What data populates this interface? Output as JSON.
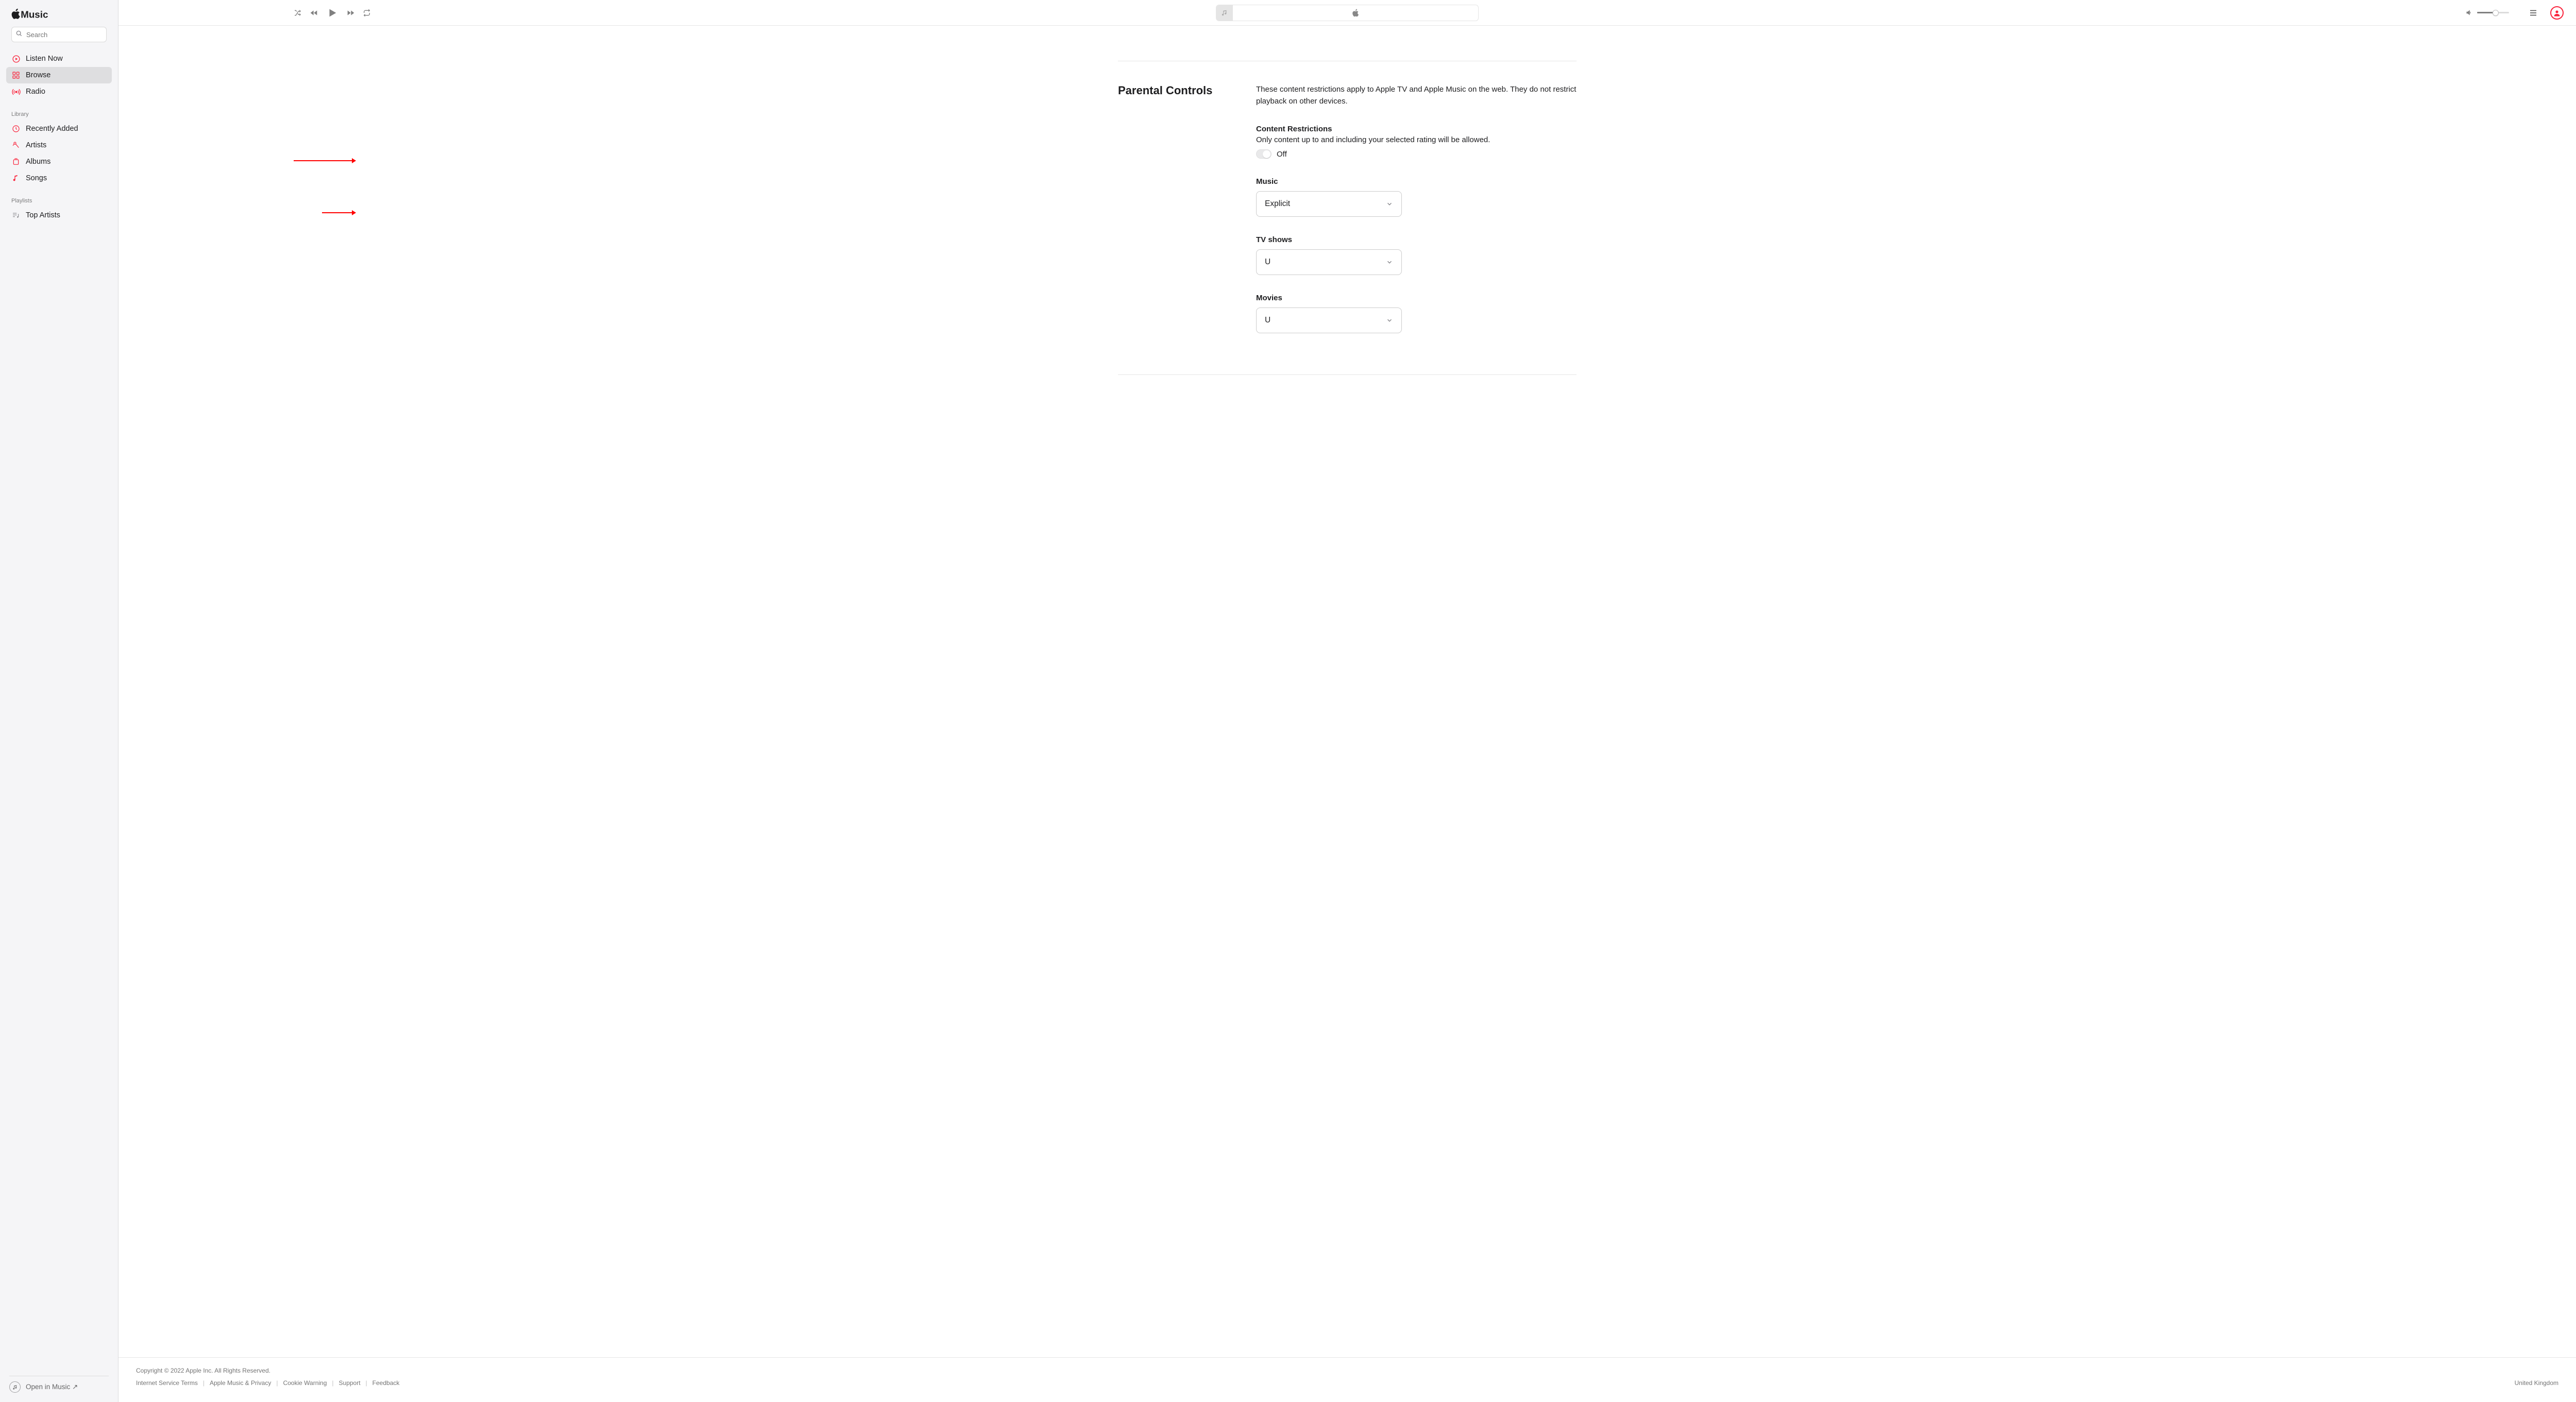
{
  "app": {
    "name": "Music"
  },
  "search": {
    "placeholder": "Search"
  },
  "sidebar": {
    "main": [
      {
        "label": "Listen Now",
        "icon": "play-circle"
      },
      {
        "label": "Browse",
        "icon": "grid",
        "active": true
      },
      {
        "label": "Radio",
        "icon": "broadcast"
      }
    ],
    "library_heading": "Library",
    "library": [
      {
        "label": "Recently Added",
        "icon": "clock"
      },
      {
        "label": "Artists",
        "icon": "mic"
      },
      {
        "label": "Albums",
        "icon": "album"
      },
      {
        "label": "Songs",
        "icon": "note"
      }
    ],
    "playlists_heading": "Playlists",
    "playlists": [
      {
        "label": "Top Artists",
        "icon": "playlist"
      }
    ],
    "open_in": "Open in Music ↗"
  },
  "settings": {
    "title": "Parental Controls",
    "description": "These content restrictions apply to Apple TV and Apple Music on the web. They do not restrict playback on other devices.",
    "restrictions_heading": "Content Restrictions",
    "restrictions_sub": "Only content up to and including your selected rating will be allowed.",
    "toggle_state_label": "Off",
    "groups": {
      "music": {
        "label": "Music",
        "value": "Explicit"
      },
      "tv": {
        "label": "TV shows",
        "value": "U"
      },
      "movies": {
        "label": "Movies",
        "value": "U"
      }
    }
  },
  "footer": {
    "copyright_prefix": "Copyright © 2022 ",
    "company": "Apple Inc.",
    "copyright_suffix": " All Rights Reserved.",
    "links": [
      "Internet Service Terms",
      "Apple Music & Privacy",
      "Cookie Warning",
      "Support",
      "Feedback"
    ],
    "region": "United Kingdom"
  }
}
